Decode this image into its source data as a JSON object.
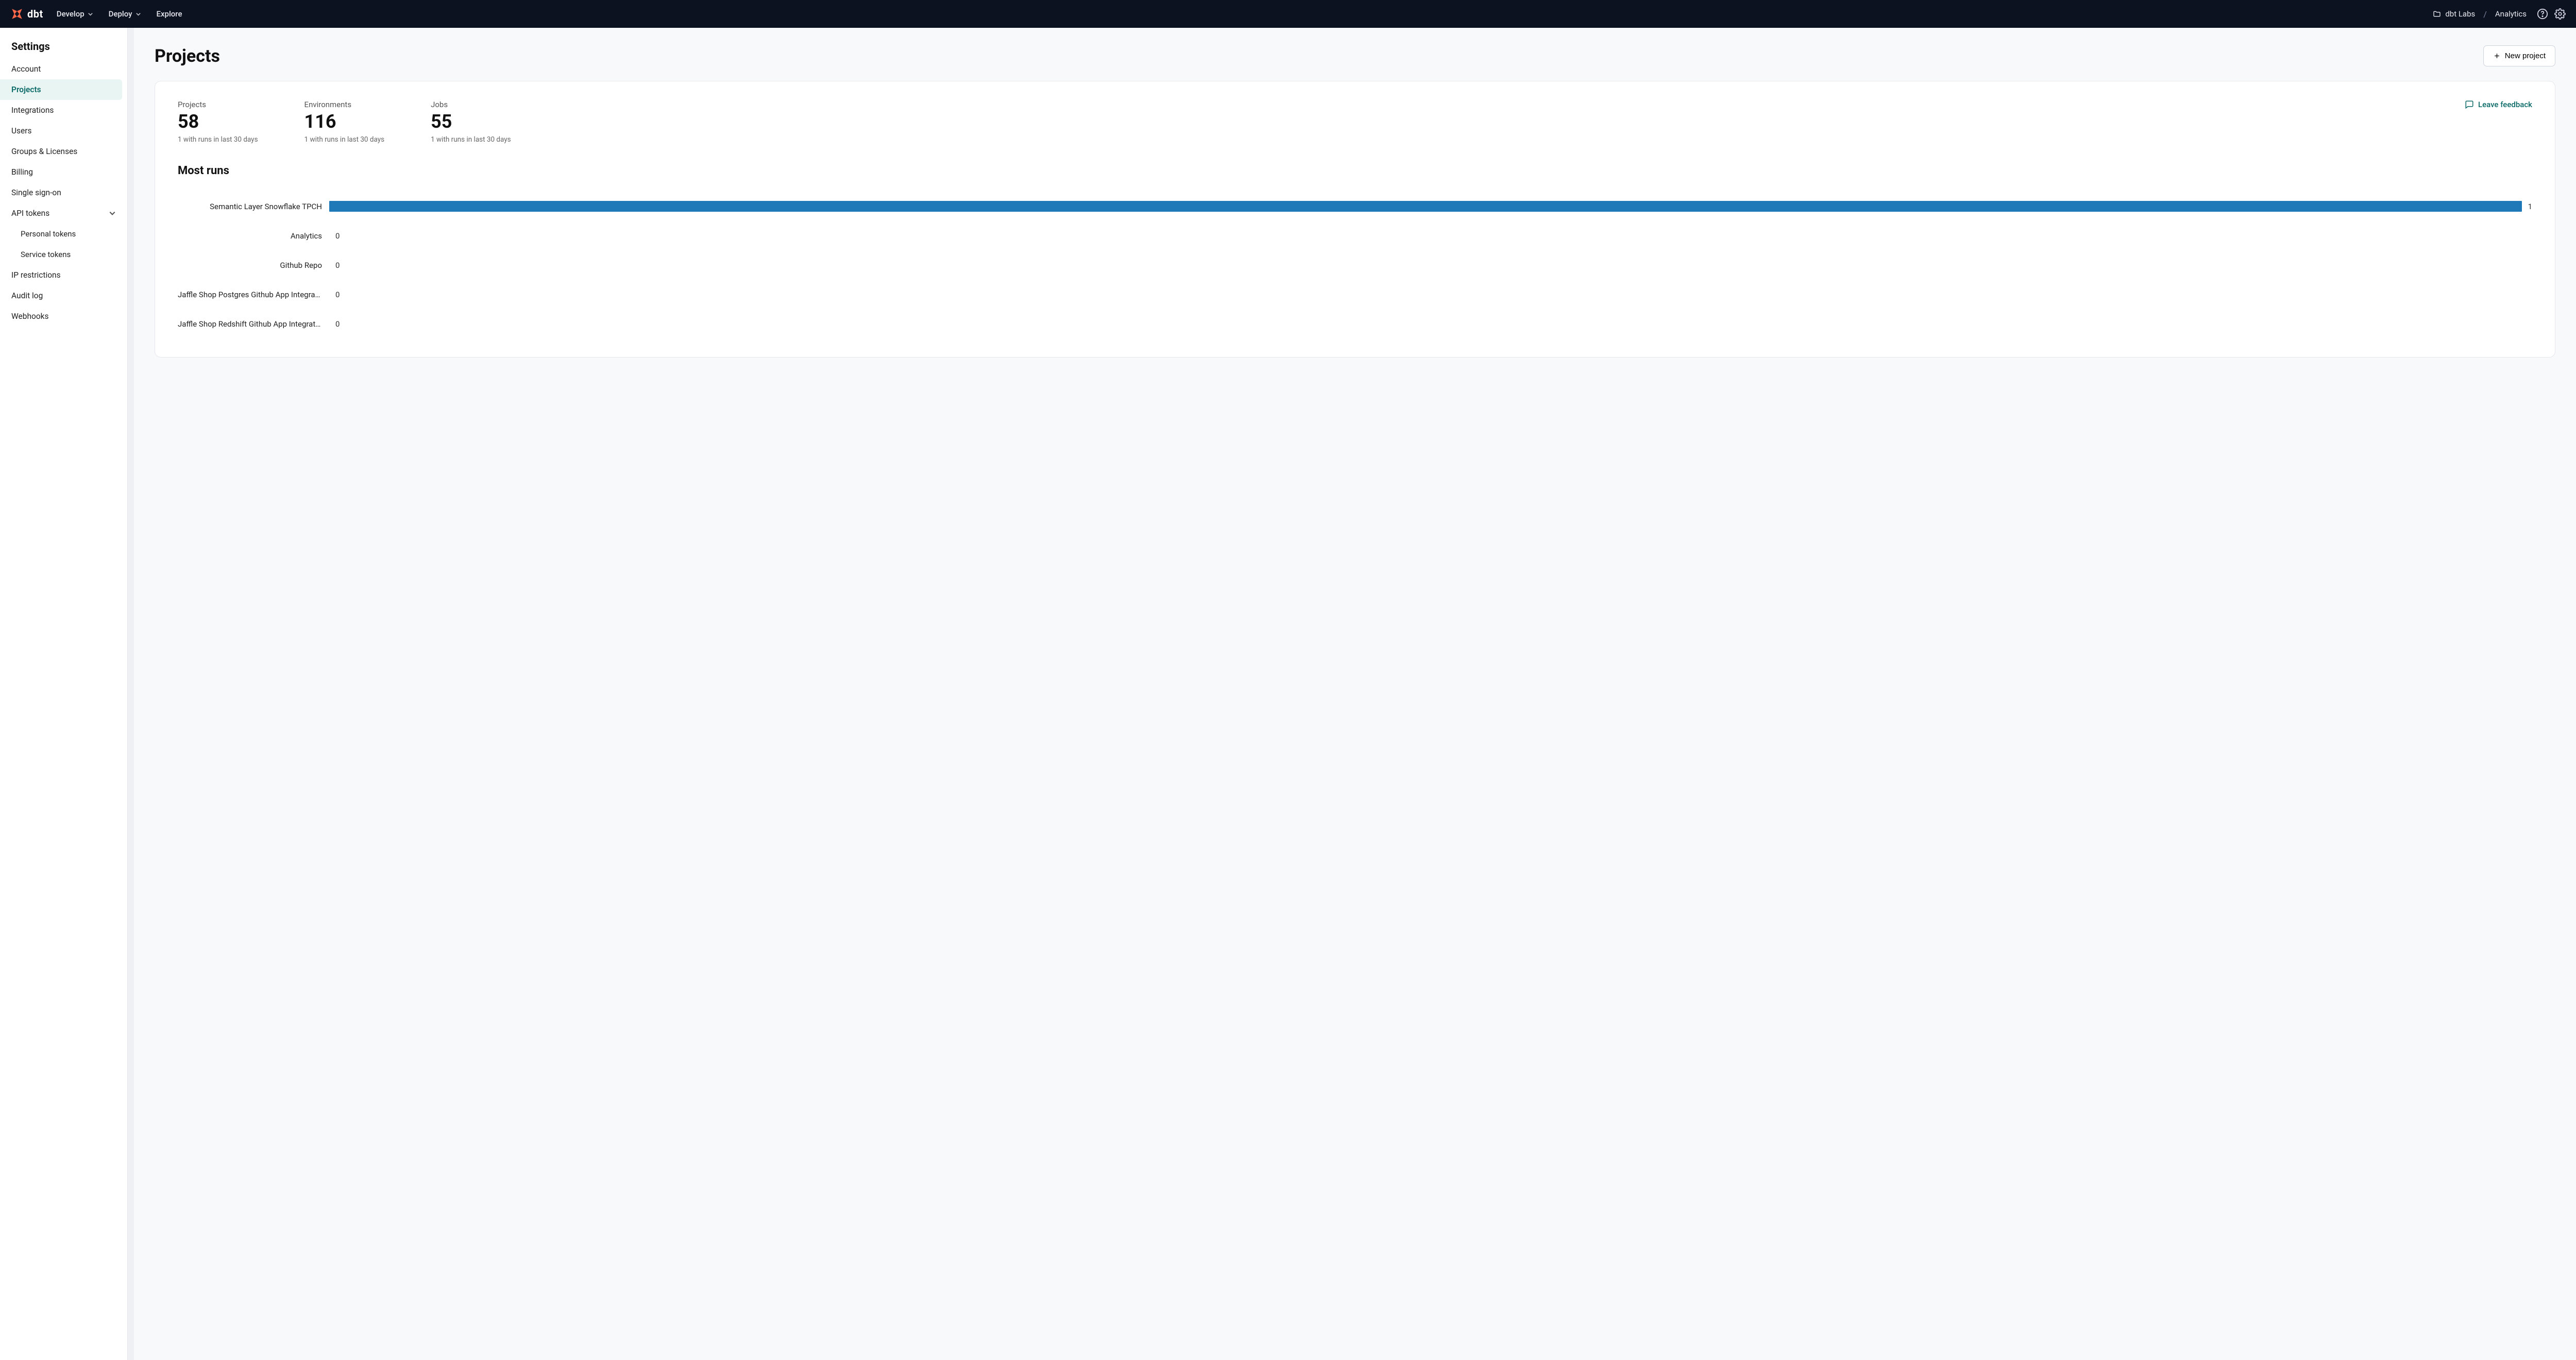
{
  "nav": {
    "brand": "dbt",
    "items": [
      {
        "label": "Develop",
        "name": "nav-develop",
        "chevron": true
      },
      {
        "label": "Deploy",
        "name": "nav-deploy",
        "chevron": true
      },
      {
        "label": "Explore",
        "name": "nav-explore",
        "chevron": false
      }
    ],
    "org": "dbt Labs",
    "project": "Analytics"
  },
  "sidebar": {
    "heading": "Settings",
    "items": [
      {
        "label": "Account",
        "name": "sidebar-item-account"
      },
      {
        "label": "Projects",
        "name": "sidebar-item-projects",
        "active": true
      },
      {
        "label": "Integrations",
        "name": "sidebar-item-integrations"
      },
      {
        "label": "Users",
        "name": "sidebar-item-users"
      },
      {
        "label": "Groups & Licenses",
        "name": "sidebar-item-groups-licenses"
      },
      {
        "label": "Billing",
        "name": "sidebar-item-billing"
      },
      {
        "label": "Single sign-on",
        "name": "sidebar-item-sso"
      },
      {
        "label": "API tokens",
        "name": "sidebar-item-api-tokens",
        "chevron": true
      },
      {
        "label": "Personal tokens",
        "name": "sidebar-item-personal-tokens",
        "sub": true
      },
      {
        "label": "Service tokens",
        "name": "sidebar-item-service-tokens",
        "sub": true
      },
      {
        "label": "IP restrictions",
        "name": "sidebar-item-ip-restrictions"
      },
      {
        "label": "Audit log",
        "name": "sidebar-item-audit-log"
      },
      {
        "label": "Webhooks",
        "name": "sidebar-item-webhooks"
      }
    ]
  },
  "page": {
    "title": "Projects",
    "new_project_label": "New project",
    "feedback_label": "Leave feedback",
    "stats": [
      {
        "label": "Projects",
        "value": "58",
        "sub": "1 with runs in last 30 days"
      },
      {
        "label": "Environments",
        "value": "116",
        "sub": "1 with runs in last 30 days"
      },
      {
        "label": "Jobs",
        "value": "55",
        "sub": "1 with runs in last 30 days"
      }
    ],
    "most_runs_heading": "Most runs"
  },
  "chart_data": {
    "type": "bar",
    "title": "Most runs",
    "xlabel": "",
    "ylabel": "",
    "ylim": [
      0,
      1
    ],
    "categories": [
      "Semantic Layer Snowflake TPCH",
      "Analytics",
      "Github Repo",
      "Jaffle Shop Postgres Github App Integration",
      "Jaffle Shop Redshift Github App Integration"
    ],
    "values": [
      1,
      0,
      0,
      0,
      0
    ]
  },
  "colors": {
    "bar": "#1f78b8",
    "accent": "#0c6b68"
  }
}
